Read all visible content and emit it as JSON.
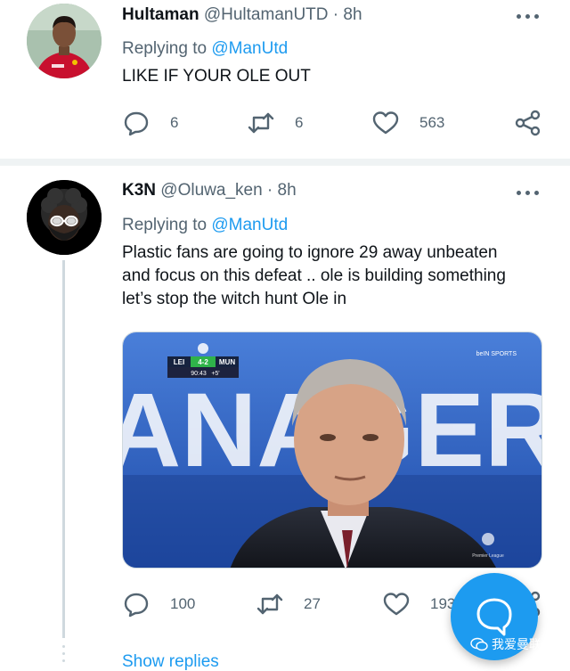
{
  "tweets": [
    {
      "display_name": "Hultaman",
      "handle": "@HultamanUTD",
      "separator": "·",
      "time": "8h",
      "replying_prefix": "Replying to",
      "replying_to": "@ManUtd",
      "text": "LIKE IF YOUR OLE OUT",
      "replies": "6",
      "retweets": "6",
      "likes": "563"
    },
    {
      "display_name": "K3N",
      "handle": "@Oluwa_ken",
      "separator": "·",
      "time": "8h",
      "replying_prefix": "Replying to",
      "replying_to": "@ManUtd",
      "text_lines": [
        "Plastic fans are going to ignore 29 away unbeaten",
        "and focus on this defeat .. ole is building something",
        "let’s stop the witch hunt Ole in"
      ],
      "media": {
        "score_home": "LEI",
        "score": "4-2",
        "score_away": "MUN",
        "match_clock": "90:43",
        "added_time": "+5'",
        "broadcaster": "beIN SPORTS",
        "league": "Premier League",
        "bg_text": "ANAGER"
      },
      "replies": "100",
      "retweets": "27",
      "likes": "193",
      "show_replies": "Show replies"
    }
  ],
  "watermark": "我爱曼联",
  "colors": {
    "accent": "#1d9bf0",
    "muted": "#536471",
    "text": "#0f1419",
    "divider": "#eff3f4"
  }
}
